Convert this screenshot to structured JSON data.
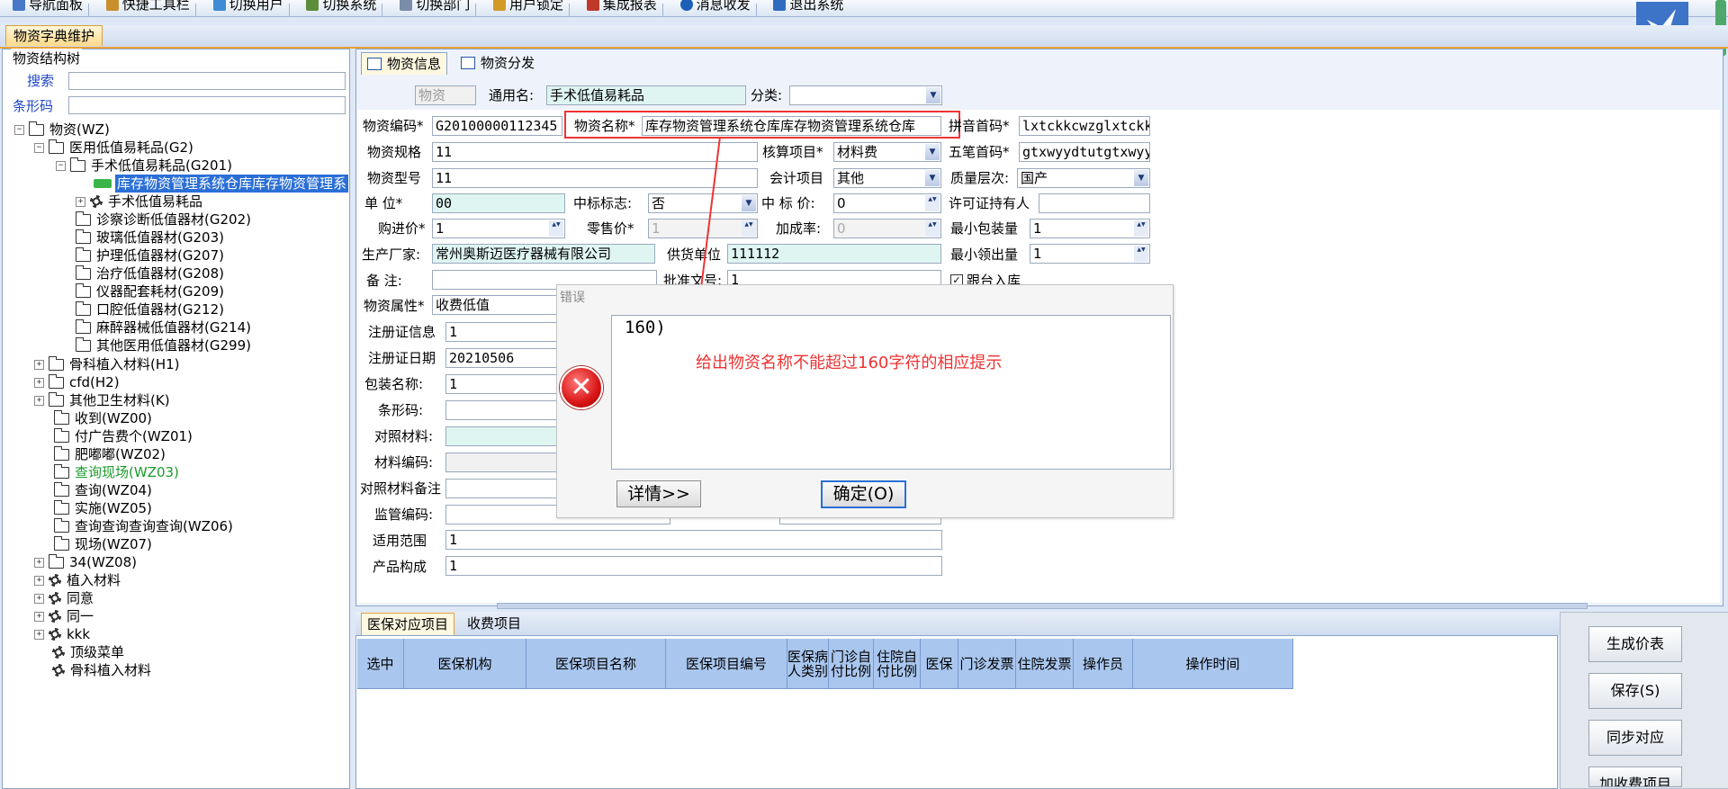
{
  "toolbar": {
    "items": [
      "导航面板",
      "快捷工具栏",
      "切换用户",
      "切换系统",
      "切换部门",
      "用户锁定",
      "集成报表",
      "消息收发",
      "退出系统"
    ]
  },
  "doc_tab": "物资字典维护",
  "left": {
    "panel_title": "物资结构树",
    "search_label": "搜索",
    "barcode_label": "条形码",
    "tree": [
      {
        "label": "物资(WZ)"
      },
      {
        "label": "医用低值易耗品(G2)"
      },
      {
        "label": "手术低值易耗品(G201)"
      },
      {
        "label": "库存物资管理系统仓库库存物资管理系"
      },
      {
        "label": "手术低值易耗品"
      },
      {
        "label": "诊察诊断低值器材(G202)"
      },
      {
        "label": "玻璃低值器材(G203)"
      },
      {
        "label": "护理低值器材(G207)"
      },
      {
        "label": "治疗低值器材(G208)"
      },
      {
        "label": "仪器配套耗材(G209)"
      },
      {
        "label": "口腔低值器材(G212)"
      },
      {
        "label": "麻醉器械低值器材(G214)"
      },
      {
        "label": "其他医用低值器材(G299)"
      },
      {
        "label": "骨科植入材料(H1)"
      },
      {
        "label": "cfd(H2)"
      },
      {
        "label": "其他卫生材料(K)"
      },
      {
        "label": "收到(WZ00)"
      },
      {
        "label": "付广告费个(WZ01)"
      },
      {
        "label": "肥嘟嘟(WZ02)"
      },
      {
        "label": "查询现场(WZ03)"
      },
      {
        "label": "查询(WZ04)"
      },
      {
        "label": "实施(WZ05)"
      },
      {
        "label": "查询查询查询查询(WZ06)"
      },
      {
        "label": "现场(WZ07)"
      },
      {
        "label": "34(WZ08)"
      },
      {
        "label": "植入材料"
      },
      {
        "label": "同意"
      },
      {
        "label": "同一"
      },
      {
        "label": "kkk"
      },
      {
        "label": "顶级菜单"
      },
      {
        "label": "骨科植入材料"
      }
    ]
  },
  "tabs": {
    "info": "物资信息",
    "dist": "物资分发"
  },
  "form": {
    "wz_badge": "物资",
    "common_name_label": "通用名:",
    "common_name": "手术低值易耗品",
    "category_label": "分类:",
    "code_label": "物资编码*",
    "code": "G20100000112345",
    "name_label": "物资名称*",
    "name": "库存物资管理系统仓库库存物资管理系统仓库",
    "pinyin_label": "拼音首码*",
    "pinyin": "lxtckkcwzglxtckkc",
    "spec_label": "物资规格",
    "spec": "11",
    "acct_item_label": "核算项目*",
    "acct_item": "材料费",
    "wubi_label": "五笔首码*",
    "wubi": "gtxwyydtutgtxwyyd",
    "model_label": "物资型号",
    "model": "11",
    "acc_item_label": "会计项目",
    "acc_item": "其他",
    "quality_label": "质量层次:",
    "quality": "国产",
    "unit_label": "单    位*",
    "unit": "00",
    "bid_label": "中标标志:",
    "bid": "否",
    "bid_price_label": "中 标 价:",
    "bid_price": "0",
    "licensee_label": "许可证持有人",
    "licensee": "",
    "purchase_label": "购进价*",
    "purchase": "1",
    "retail_label": "零售价*",
    "retail": "1",
    "markup_label": "加成率:",
    "markup": "0",
    "min_pack_label": "最小包装量",
    "min_pack": "1",
    "maker_label": "生产厂家:",
    "maker": "常州奥斯迈医疗器械有限公司",
    "supplier_label": "供货单位",
    "supplier": "111112",
    "min_get_label": "最小领出量",
    "min_get": "1",
    "remark_label": "备    注:",
    "approval_label": "批准文号:",
    "approval": "1",
    "follow_label": "跟台入库",
    "attr_label": "物资属性*",
    "attr": "收费低值",
    "reg_info_label": "注册证信息",
    "reg_info": "1",
    "reg_date_label": "注册证日期",
    "reg_date": "20210506",
    "pack_label": "包装名称:",
    "pack": "1",
    "barcode_label": "条形码:",
    "compare_label": "对照材料:",
    "mat_code_label": "材料编码:",
    "compare_rem_label": "对照材料备注",
    "super_label": "监管编码:",
    "scope_label": "适用范围",
    "scope": "1",
    "compose_label": "产品构成",
    "compose": "1"
  },
  "dialog": {
    "title": "错误",
    "message": "160)",
    "annotation": "给出物资名称不能超过160字符的相应提示",
    "details_btn": "详情>>",
    "ok_btn": "确定(O)"
  },
  "bottom": {
    "tab1": "医保对应项目",
    "tab2": "收费项目",
    "columns": [
      "选中",
      "医保机构",
      "医保项目名称",
      "医保项目编号",
      "医保病人类别",
      "门诊自付比例",
      "住院自付比例",
      "医保",
      "门诊发票",
      "住院发票",
      "操作员",
      "操作时间"
    ]
  },
  "side_buttons": {
    "gen": "生成价表",
    "save": "保存(S)",
    "sync": "同步对应",
    "add": "加收费项目"
  },
  "colors": {
    "accent": "#2b6fd6",
    "error_red": "#e33333",
    "selected_green": "#1a9b2c"
  }
}
